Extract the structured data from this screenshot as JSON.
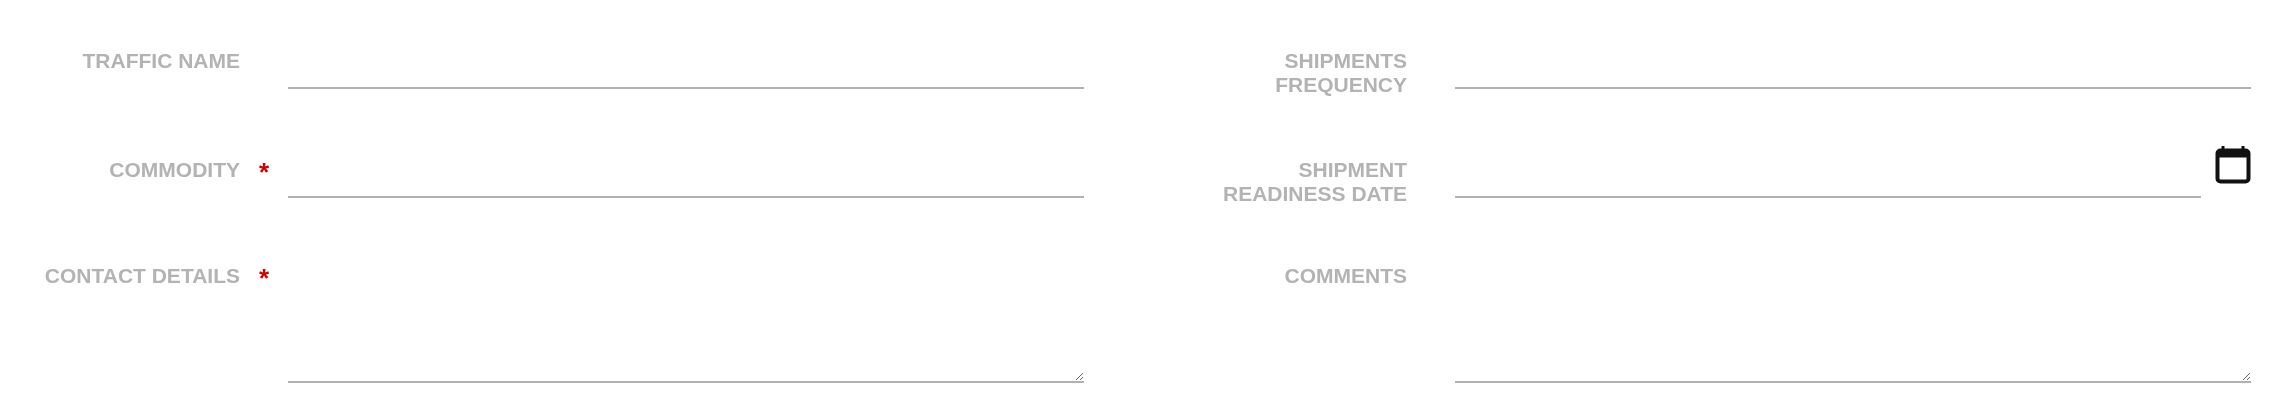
{
  "required_marker": "*",
  "columns": [
    [
      {
        "kind": "text",
        "label": "TRAFFIC NAME",
        "required": false
      },
      {
        "kind": "text",
        "label": "COMMODITY",
        "required": true
      },
      {
        "kind": "textarea",
        "label": "CONTACT DETAILS",
        "required": true
      }
    ],
    [
      {
        "kind": "text",
        "label": "SHIPMENTS FREQUENCY",
        "required": false
      },
      {
        "kind": "date",
        "label": "SHIPMENT READINESS DATE",
        "required": false
      },
      {
        "kind": "textarea",
        "label": "COMMENTS",
        "required": false
      }
    ]
  ]
}
